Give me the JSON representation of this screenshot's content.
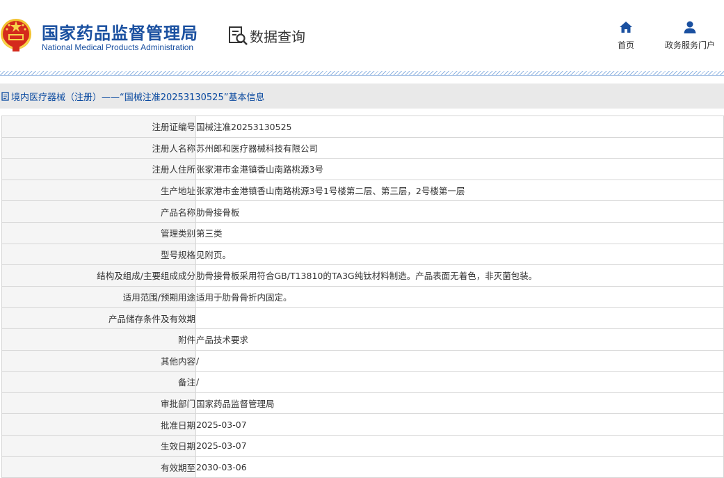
{
  "header": {
    "agency_cn": "国家药品监督管理局",
    "agency_en": "National Medical Products Administration",
    "query_title": "数据查询",
    "nav": [
      {
        "label": "首页",
        "icon": "home-icon"
      },
      {
        "label": "政务服务门户",
        "icon": "user-icon"
      }
    ]
  },
  "page": {
    "title": "境内医疗器械（注册）——“国械注准20253130525”基本信息"
  },
  "colors": {
    "brand_blue": "#1a50a0",
    "title_text": "#0b4aa0",
    "title_bar_bg": "#e9e9e9",
    "label_bg": "#f5f5f5",
    "border": "#d6d6d6"
  },
  "rows": [
    {
      "label": "注册证编号",
      "value": "国械注准20253130525"
    },
    {
      "label": "注册人名称",
      "value": "苏州郎和医疗器械科技有限公司"
    },
    {
      "label": "注册人住所",
      "value": "张家港市金港镇香山南路桃源3号"
    },
    {
      "label": "生产地址",
      "value": "张家港市金港镇香山南路桃源3号1号楼第二层、第三层，2号楼第一层"
    },
    {
      "label": "产品名称",
      "value": "肋骨接骨板"
    },
    {
      "label": "管理类别",
      "value": "第三类"
    },
    {
      "label": "型号规格",
      "value": "见附页。"
    },
    {
      "label": "结构及组成/主要组成成分",
      "value": "肋骨接骨板采用符合GB/T13810的TA3G纯钛材料制造。产品表面无着色，非灭菌包装。"
    },
    {
      "label": "适用范围/预期用途",
      "value": "适用于肋骨骨折内固定。"
    },
    {
      "label": "产品储存条件及有效期",
      "value": ""
    },
    {
      "label": "附件",
      "value": "产品技术要求"
    },
    {
      "label": "其他内容",
      "value": "/"
    },
    {
      "label": "备注",
      "value": "/"
    },
    {
      "label": "审批部门",
      "value": "国家药品监督管理局"
    },
    {
      "label": "批准日期",
      "value": "2025-03-07"
    },
    {
      "label": "生效日期",
      "value": "2025-03-07"
    },
    {
      "label": "有效期至",
      "value": "2030-03-06"
    }
  ]
}
